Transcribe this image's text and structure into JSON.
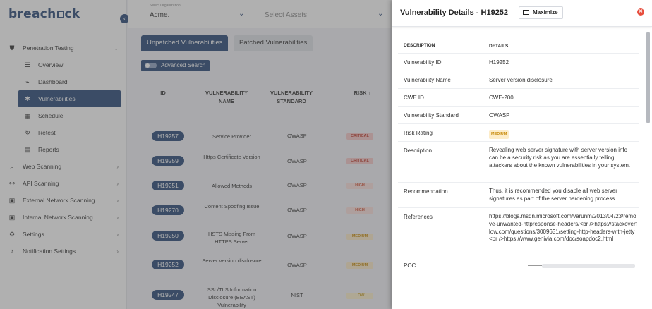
{
  "app": {
    "logo_text_a": "breach",
    "logo_text_b": "ck"
  },
  "sidebar": {
    "collapse_icon": "chevron-left-icon",
    "items": [
      {
        "label": "Penetration Testing",
        "icon": "shield-icon"
      },
      {
        "label": "Overview",
        "icon": "list-icon"
      },
      {
        "label": "Dashboard",
        "icon": "chart-icon"
      },
      {
        "label": "Vulnerabilities",
        "icon": "bug-icon"
      },
      {
        "label": "Schedule",
        "icon": "calendar-icon"
      },
      {
        "label": "Retest",
        "icon": "retest-icon"
      },
      {
        "label": "Reports",
        "icon": "report-icon"
      },
      {
        "label": "Web Scanning",
        "icon": "search-icon"
      },
      {
        "label": "API Scanning",
        "icon": "api-icon"
      },
      {
        "label": "External Network Scanning",
        "icon": "network-icon"
      },
      {
        "label": "Internal Network Scanning",
        "icon": "network-icon"
      },
      {
        "label": "Settings",
        "icon": "gear-icon"
      },
      {
        "label": "Notification Settings",
        "icon": "bell-icon"
      }
    ]
  },
  "topbar": {
    "org_label": "Select Organization",
    "org_value": "Acme.",
    "assets_placeholder": "Select Assets"
  },
  "tabs": {
    "unpatched": "Unpatched Vulnerabilities",
    "patched": "Patched Vulnerabilities"
  },
  "advanced_search": "Advanced Search",
  "table": {
    "headers": {
      "id": "ID",
      "name": "VULNERABILITY NAME",
      "standard": "VULNERABILITY STANDARD",
      "risk": "RISK",
      "sort_icon": "arrow-up-icon"
    },
    "rows": [
      {
        "id": "H19257",
        "name": "Service Provider",
        "standard": "OWASP",
        "risk": "CRITICAL"
      },
      {
        "id": "H19259",
        "name": "Https Certificate Version",
        "standard": "OWASP",
        "risk": "CRITICAL"
      },
      {
        "id": "H19251",
        "name": "Allowed Methods",
        "standard": "OWASP",
        "risk": "HIGH"
      },
      {
        "id": "H19270",
        "name": "Content Spoofing Issue",
        "standard": "OWASP",
        "risk": "HIGH"
      },
      {
        "id": "H19250",
        "name": "HSTS Missing From HTTPS Server",
        "standard": "OWASP",
        "risk": "MEDIUM"
      },
      {
        "id": "H19252",
        "name": "Server version disclosure",
        "standard": "OWASP",
        "risk": "MEDIUM"
      },
      {
        "id": "H19247",
        "name": "SSL/TLS Information Disclosure (BEAST) Vulnerability",
        "standard": "NIST",
        "risk": "LOW"
      }
    ]
  },
  "drawer": {
    "title": "Vulnerability Details - H19252",
    "maximize": "Maximize",
    "close_icon": "close-icon",
    "col_description": "DESCRIPTION",
    "col_details": "DETAILS",
    "rows": [
      {
        "k": "Vulnerability ID",
        "v": "H19252"
      },
      {
        "k": "Vulnerability Name",
        "v": "Server version disclosure"
      },
      {
        "k": "CWE ID",
        "v": "CWE-200"
      },
      {
        "k": "Vulnerability Standard",
        "v": "OWASP"
      },
      {
        "k": "Risk Rating",
        "v": "MEDIUM"
      },
      {
        "k": "Description",
        "v": "Revealing web server signature with server version info can be a security risk as you are essentially telling attackers about the known vulnerabilities in your system."
      },
      {
        "k": "Recommendation",
        "v": "Thus, it is recommended you disable all web server signatures as part of the server hardening process."
      },
      {
        "k": "References",
        "v": "https://blogs.msdn.microsoft.com/varunm/2013/04/23/remove-unwanted-httpresponse-headers/<br />https://stackoverflow.com/questions/3009631/setting-http-headers-with-jetty<br />https://www.genivia.com/doc/soapdoc2.html"
      },
      {
        "k": "POC",
        "v": ""
      }
    ]
  },
  "colors": {
    "brand": "#2b4a78",
    "critical": "#c0392b",
    "high": "#d35439",
    "medium": "#c78a0b",
    "close": "#e74c3c"
  }
}
